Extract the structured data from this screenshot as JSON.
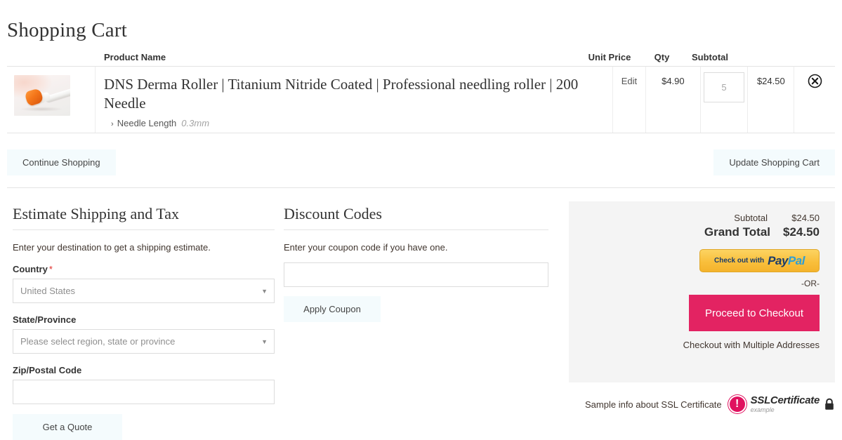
{
  "page": {
    "title": "Shopping Cart"
  },
  "cart": {
    "headers": {
      "product": "Product Name",
      "unit_price": "Unit Price",
      "qty": "Qty",
      "subtotal": "Subtotal"
    },
    "items": [
      {
        "name": "DNS Derma Roller | Titanium Nitride Coated | Professional needling roller | 200 Needle",
        "option_label": "Needle Length",
        "option_value": "0.3mm",
        "option_chevron": "chevron-right-icon",
        "edit_label": "Edit",
        "unit_price": "$4.90",
        "qty": "5",
        "subtotal": "$24.50",
        "remove_icon": "remove-circle-icon",
        "image": "derma-roller-thumbnail"
      }
    ]
  },
  "actions": {
    "continue_shopping": "Continue Shopping",
    "update_cart": "Update Shopping Cart"
  },
  "shipping": {
    "title": "Estimate Shipping and Tax",
    "note": "Enter your destination to get a shipping estimate.",
    "country_label": "Country",
    "country_required_marker": "*",
    "country_value": "United States",
    "state_label": "State/Province",
    "state_value": "Please select region, state or province",
    "zip_label": "Zip/Postal Code",
    "zip_value": "",
    "zip_placeholder": "",
    "quote_button": "Get a Quote",
    "caret_icon": "chevron-down-icon"
  },
  "discount": {
    "title": "Discount Codes",
    "note": "Enter your coupon code if you have one.",
    "coupon_value": "",
    "coupon_placeholder": "",
    "apply_button": "Apply Coupon"
  },
  "summary": {
    "subtotal_label": "Subtotal",
    "subtotal_value": "$24.50",
    "grand_total_label": "Grand Total",
    "grand_total_value": "$24.50",
    "paypal_prefix": "Check out with",
    "paypal_pay": "Pay",
    "paypal_pal": "Pal",
    "or_text": "-OR-",
    "checkout_button": "Proceed to Checkout",
    "multi_address_link": "Checkout with Multiple Addresses"
  },
  "ssl": {
    "text": "Sample info about SSL Certificate",
    "mark_glyph": "!",
    "name": "SSLCertificate",
    "sub": "example",
    "lock_icon": "lock-icon"
  },
  "colors": {
    "accent_pink": "#e32362",
    "paypal_gold": "#f9bf3c",
    "paypal_navy": "#1b3c69",
    "paypal_blue": "#2e9fd6",
    "soft_button_bg": "#f4fbfd",
    "panel_bg": "#f4f4f4",
    "required_red": "#e02b27"
  }
}
